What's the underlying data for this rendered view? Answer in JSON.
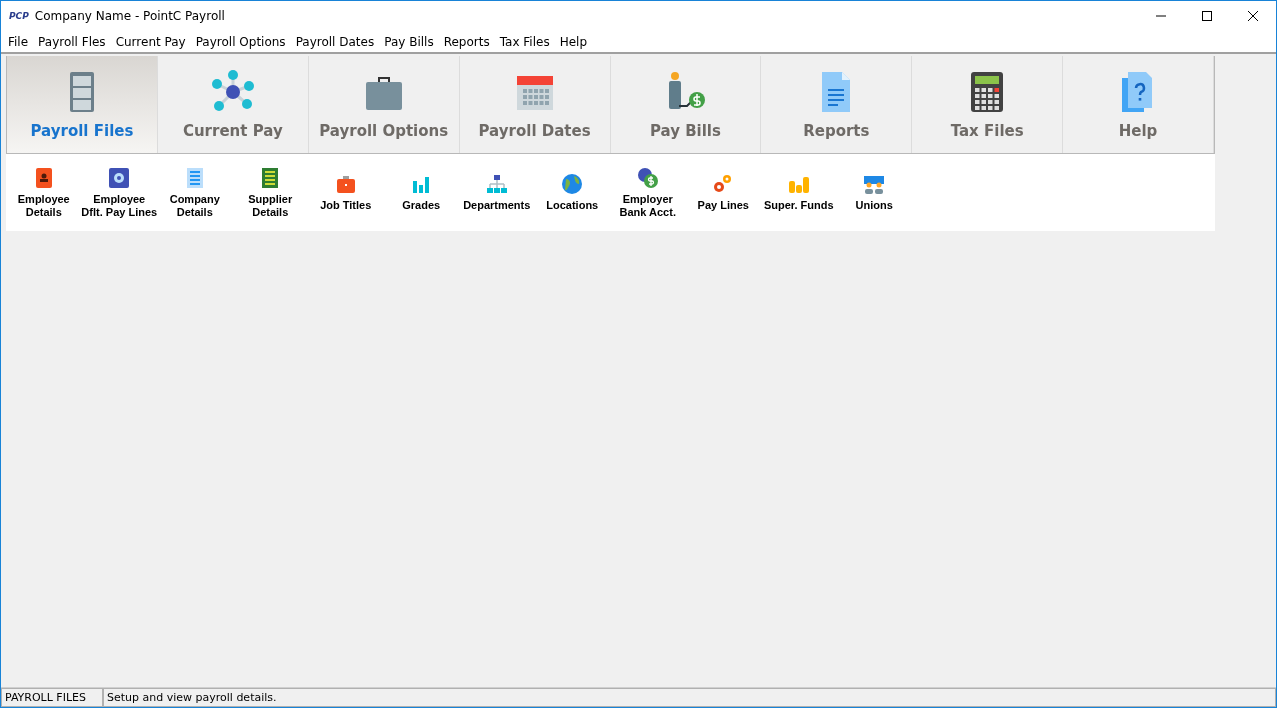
{
  "window": {
    "logo": "PCP",
    "title": "Company Name - PointC Payroll"
  },
  "menu": [
    "File",
    "Payroll Fles",
    "Current Pay",
    "Payroll Options",
    "Payroll Dates",
    "Pay Bills",
    "Reports",
    "Tax Files",
    "Help"
  ],
  "tabs": [
    {
      "label": "Payroll Files",
      "selected": true
    },
    {
      "label": "Current Pay",
      "selected": false
    },
    {
      "label": "Payroll Options",
      "selected": false
    },
    {
      "label": "Payroll Dates",
      "selected": false
    },
    {
      "label": "Pay Bills",
      "selected": false
    },
    {
      "label": "Reports",
      "selected": false
    },
    {
      "label": "Tax Files",
      "selected": false
    },
    {
      "label": "Help",
      "selected": false
    }
  ],
  "toolbar": [
    {
      "lines": [
        "Employee",
        "Details"
      ]
    },
    {
      "lines": [
        "Employee",
        "Dflt. Pay Lines"
      ]
    },
    {
      "lines": [
        "Company",
        "Details"
      ]
    },
    {
      "lines": [
        "Supplier",
        "Details"
      ]
    },
    {
      "lines": [
        "Job Titles"
      ]
    },
    {
      "lines": [
        "Grades"
      ]
    },
    {
      "lines": [
        "Departments"
      ]
    },
    {
      "lines": [
        "Locations"
      ]
    },
    {
      "lines": [
        "Employer",
        "Bank Acct."
      ]
    },
    {
      "lines": [
        "Pay Lines"
      ]
    },
    {
      "lines": [
        "Super. Funds"
      ]
    },
    {
      "lines": [
        "Unions"
      ]
    }
  ],
  "status_bar": {
    "section": "PAYROLL FILES",
    "message": "Setup and view payroll details."
  }
}
